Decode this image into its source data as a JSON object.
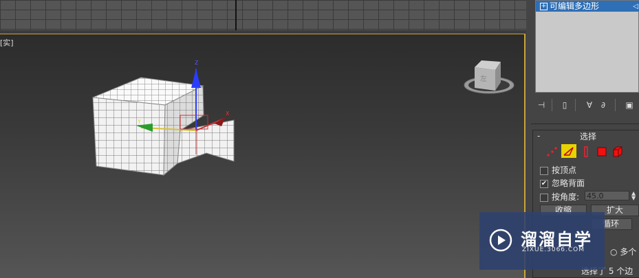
{
  "viewport": {
    "label": "[实]",
    "accent_color": "#c9a53a",
    "gizmo_axes": {
      "x": "X",
      "y": "Y",
      "z": "Z"
    },
    "viewcube_face": "左"
  },
  "modifier_stack": {
    "item_label": "可编辑多边形",
    "highlight_color": "#2e6fb6"
  },
  "stack_toolbar": {
    "icons": [
      "pin-icon",
      "show-end-result-icon",
      "make-unique-icon",
      "remove-modifier-icon",
      "configure-icon"
    ]
  },
  "selection_rollout": {
    "collapse_symbol": "-",
    "title": "选择",
    "subobject_icons": [
      "vertex-icon",
      "edge-icon",
      "border-icon",
      "polygon-icon",
      "element-icon"
    ],
    "by_vertex_label": "按顶点",
    "by_vertex_checked": false,
    "ignore_backfacing_label": "忽略背面",
    "ignore_backfacing_checked": true,
    "by_angle_label": "按角度:",
    "by_angle_checked": false,
    "by_angle_value": "45.0",
    "shrink_label": "收缩",
    "grow_label": "扩大",
    "loop_label": "循环",
    "multiple_label": "多个",
    "status": "选择了 5 个边"
  },
  "watermark": {
    "title": "溜溜自学",
    "url": "ZIXUE.3066.COM"
  }
}
